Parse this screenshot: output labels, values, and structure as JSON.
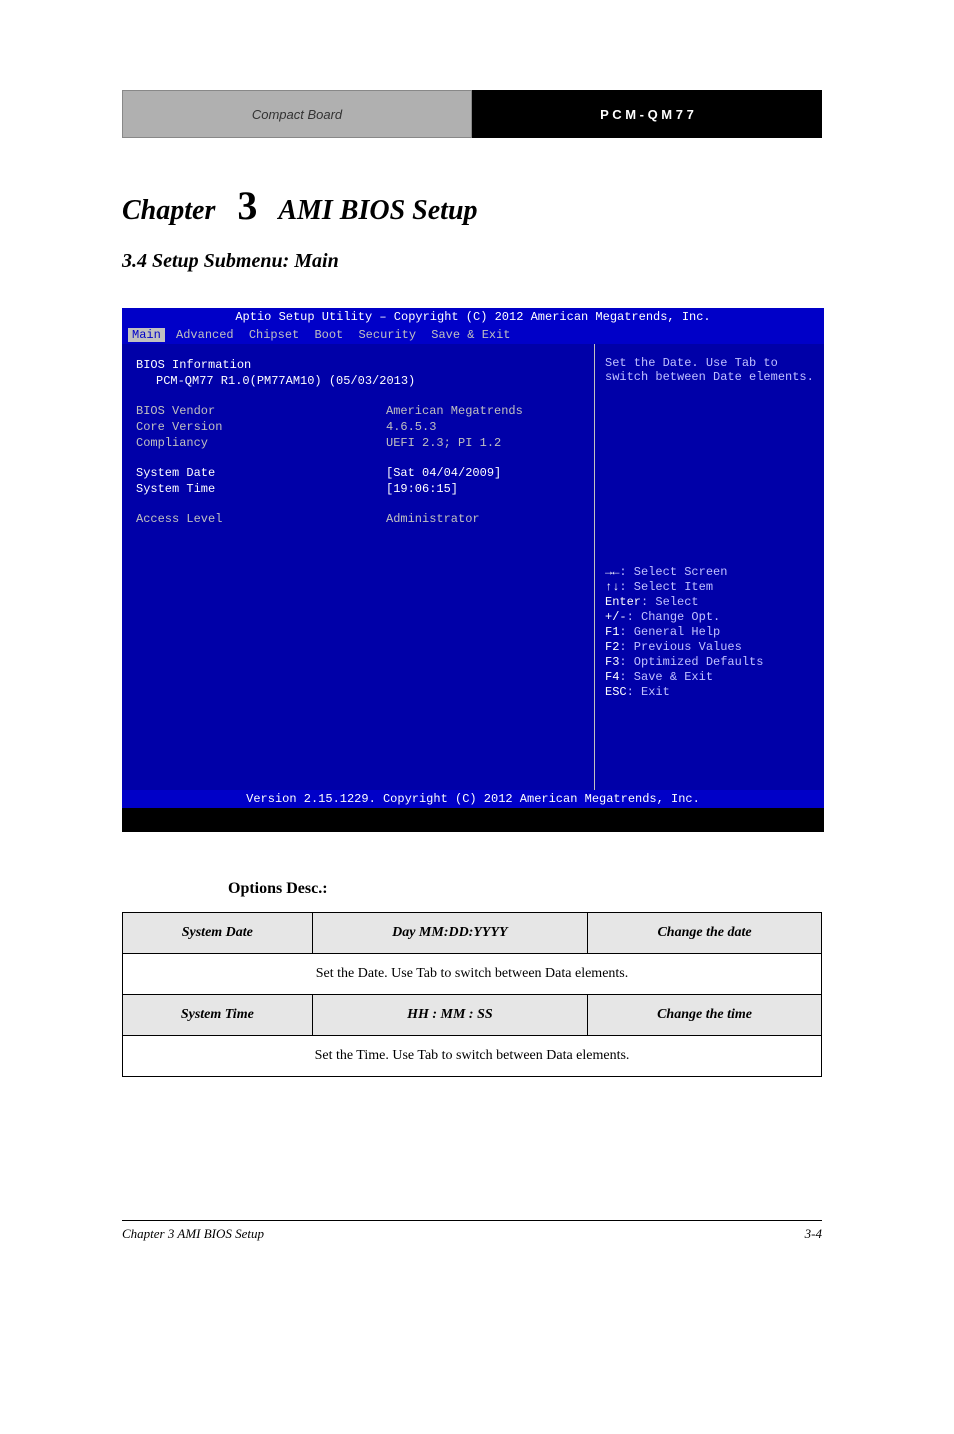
{
  "banner": {
    "left": "Compact Board",
    "right": "P C M - Q M 7 7"
  },
  "chapter": {
    "prefix": "Chapter",
    "num": "3",
    "title": "AMI BIOS Setup"
  },
  "section": "3.4 Setup Submenu: Main",
  "bios": {
    "header": "Aptio Setup Utility – Copyright (C) 2012 American Megatrends, Inc.",
    "tabs": [
      "Main",
      "Advanced",
      "Chipset",
      "Boot",
      "Security",
      "Save & Exit"
    ],
    "info_title": "BIOS Information",
    "board": "PCM-QM77 R1.0(PM77AM10) (05/03/2013)",
    "rows": [
      {
        "label": "BIOS Vendor",
        "val": "American Megatrends"
      },
      {
        "label": "Core Version",
        "val": "4.6.5.3"
      },
      {
        "label": "Compliancy",
        "val": "UEFI 2.3; PI 1.2"
      }
    ],
    "date_label": "System Date",
    "date_val": "[Sat 04/04/2009]",
    "time_label": "System Time",
    "time_val": "[19:06:15]",
    "access_label": "Access Level",
    "access_val": "Administrator",
    "help_text_1": "Set the Date. Use Tab to",
    "help_text_2": "switch between Date elements.",
    "keys": [
      {
        "sym": "→←",
        "txt": ": Select Screen"
      },
      {
        "sym": "↑↓",
        "txt": ": Select Item"
      },
      {
        "sym": "Enter",
        "txt": ": Select"
      },
      {
        "sym": "+/-",
        "txt": ": Change Opt."
      },
      {
        "sym": "F1",
        "txt": ": General Help"
      },
      {
        "sym": "F2",
        "txt": ": Previous Values"
      },
      {
        "sym": "F3",
        "txt": ": Optimized Defaults"
      },
      {
        "sym": "F4",
        "txt": ": Save & Exit"
      },
      {
        "sym": "ESC",
        "txt": ": Exit"
      }
    ],
    "footer": "Version 2.15.1229. Copyright (C) 2012 American Megatrends, Inc."
  },
  "opt_desc": "Options Desc.:",
  "table": {
    "hdr1": [
      "System Date",
      "Day MM:DD:YYYY",
      "Change the date"
    ],
    "row1": "Set the Date. Use Tab to switch between Data elements.",
    "hdr2": [
      "System Time",
      "HH : MM : SS",
      "Change the time"
    ],
    "row2": "Set the Time. Use Tab to switch between Data elements."
  },
  "footer": {
    "left": "Chapter 3 AMI BIOS Setup",
    "right": "3-4"
  },
  "chart_data": null
}
